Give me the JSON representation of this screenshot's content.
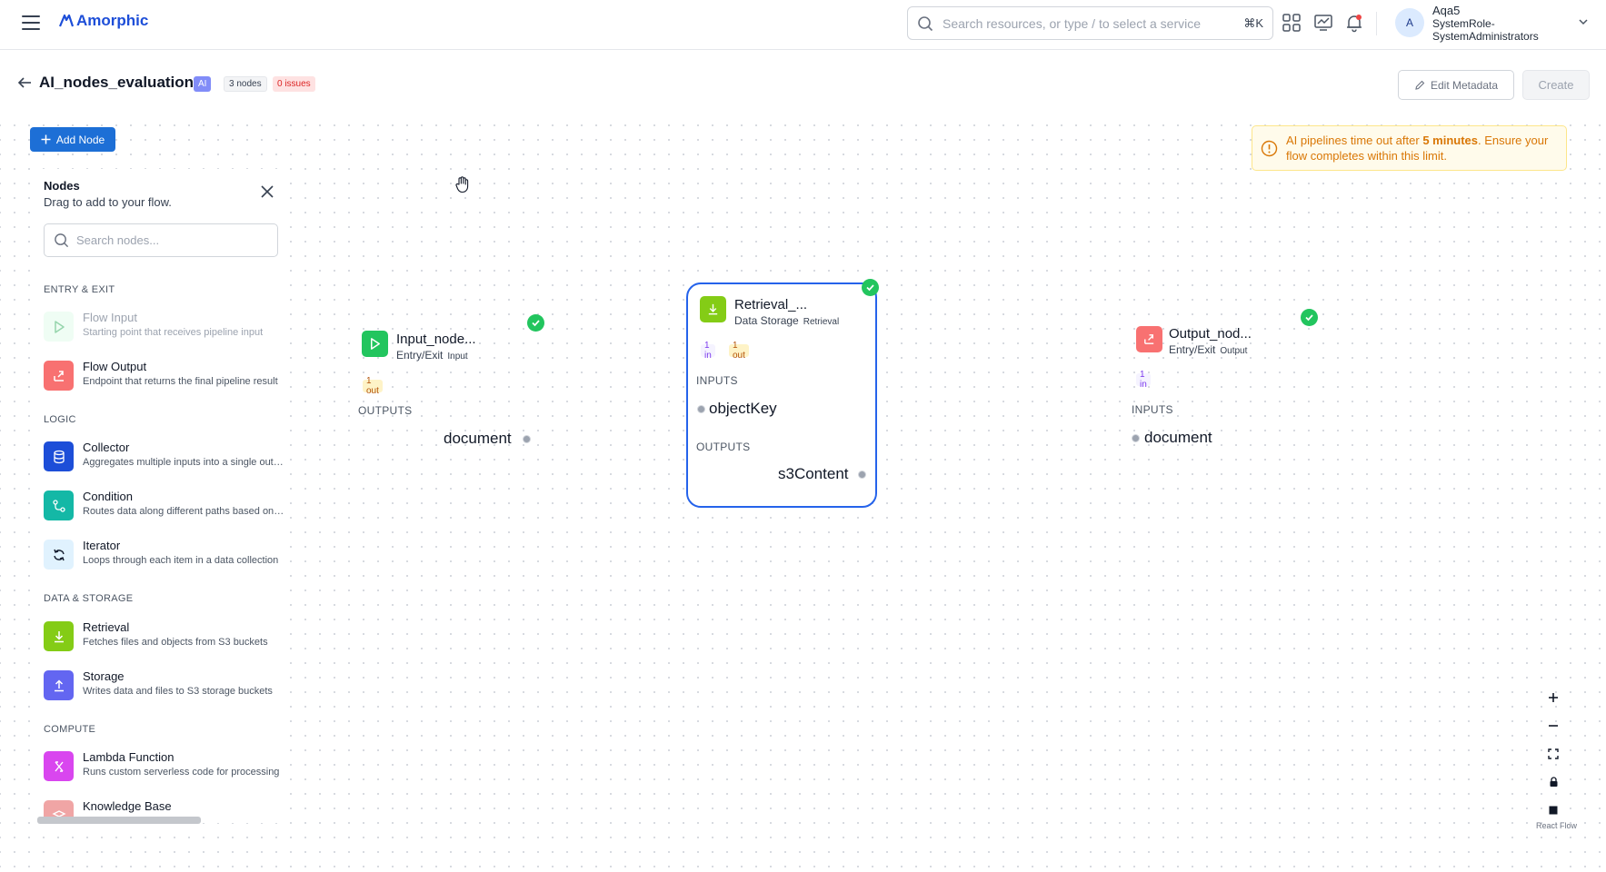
{
  "app": {
    "brand": "Amorphic",
    "search_placeholder": "Search resources, or type / to select a service",
    "search_shortcut": "⌘K",
    "user": {
      "avatar_initial": "A",
      "name": "Aqa5",
      "role_line1": "SystemRole-",
      "role_line2": "SystemAdministrators"
    }
  },
  "page": {
    "title": "AI_nodes_evaluation",
    "badge_ai": "AI",
    "badge_nodes": "3 nodes",
    "badge_issues": "0 issues",
    "edit_metadata": "Edit Metadata",
    "create": "Create"
  },
  "canvas": {
    "add_node": "Add Node",
    "alert": {
      "prefix": "AI pipelines time out after ",
      "bold": "5 minutes",
      "suffix": ". Ensure your flow completes within this limit."
    },
    "react_flow": "React Flow"
  },
  "palette": {
    "title": "Nodes",
    "subtitle": "Drag to add to your flow.",
    "search_placeholder": "Search nodes...",
    "sections": {
      "entry_exit": "ENTRY & EXIT",
      "logic": "LOGIC",
      "data_storage": "DATA & STORAGE",
      "compute": "COMPUTE"
    },
    "items": [
      {
        "title": "Flow Input",
        "desc": "Starting point that receives pipeline input"
      },
      {
        "title": "Flow Output",
        "desc": "Endpoint that returns the final pipeline result"
      },
      {
        "title": "Collector",
        "desc": "Aggregates multiple inputs into a single output"
      },
      {
        "title": "Condition",
        "desc": "Routes data along different paths based on rules"
      },
      {
        "title": "Iterator",
        "desc": "Loops through each item in a data collection"
      },
      {
        "title": "Retrieval",
        "desc": "Fetches files and objects from S3 buckets"
      },
      {
        "title": "Storage",
        "desc": "Writes data and files to S3 storage buckets"
      },
      {
        "title": "Lambda Function",
        "desc": "Runs custom serverless code for processing"
      },
      {
        "title": "Knowledge Base",
        "desc": ""
      }
    ]
  },
  "nodes": {
    "input": {
      "title": "Input_node...",
      "category": "Entry/Exit",
      "tag": "Input",
      "out_pill": "1 out",
      "outputs_label": "OUTPUTS",
      "output_port": "document"
    },
    "retrieval": {
      "title": "Retrieval_...",
      "category": "Data Storage",
      "tag": "Retrieval",
      "in_pill": "1 in",
      "out_pill": "1 out",
      "inputs_label": "INPUTS",
      "input_port": "objectKey",
      "outputs_label": "OUTPUTS",
      "output_port": "s3Content"
    },
    "output": {
      "title": "Output_nod...",
      "category": "Entry/Exit",
      "tag": "Output",
      "in_pill": "1 in",
      "inputs_label": "INPUTS",
      "input_port": "document"
    }
  },
  "colors": {
    "primary": "#1d6fd6",
    "selected_border": "#2563eb",
    "success": "#22c55e",
    "warning_text": "#d97706"
  }
}
